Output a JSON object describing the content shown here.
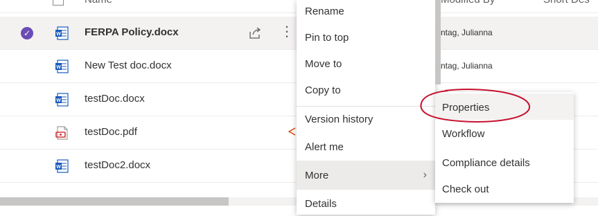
{
  "list": {
    "headers": {
      "name": "Name",
      "modified_by": "Modified By",
      "description": "Short Des"
    },
    "rows": [
      {
        "name": "FERPA Policy.docx",
        "type": "word",
        "selected": true,
        "modified_by": "ntag, Julianna"
      },
      {
        "name": "New Test doc.docx",
        "type": "word",
        "selected": false,
        "modified_by": "ntag, Julianna"
      },
      {
        "name": "testDoc.docx",
        "type": "word",
        "selected": false,
        "modified_by": ""
      },
      {
        "name": "testDoc.pdf",
        "type": "pdf",
        "selected": false,
        "modified_by": ""
      },
      {
        "name": "testDoc2.docx",
        "type": "word",
        "selected": false,
        "modified_by": ""
      }
    ]
  },
  "context_menu": {
    "items": [
      "Rename",
      "Pin to top",
      "Move to",
      "Copy to",
      "Version history",
      "Alert me",
      "More",
      "Details"
    ],
    "active_item": "More"
  },
  "submenu": {
    "items": [
      "Properties",
      "Workflow",
      "Compliance details",
      "Check out"
    ],
    "hover_item": "Properties"
  },
  "colors": {
    "selection_check": "#6b4bb5",
    "word_blue": "#185abd",
    "pdf_red": "#d13438",
    "annotation_red": "#c8102e"
  },
  "icons": {
    "check": "checkmark-icon",
    "word": "word-doc-icon",
    "pdf": "pdf-doc-icon",
    "share": "share-icon",
    "more": "more-vertical-icon",
    "chevron": "chevron-right-icon"
  }
}
